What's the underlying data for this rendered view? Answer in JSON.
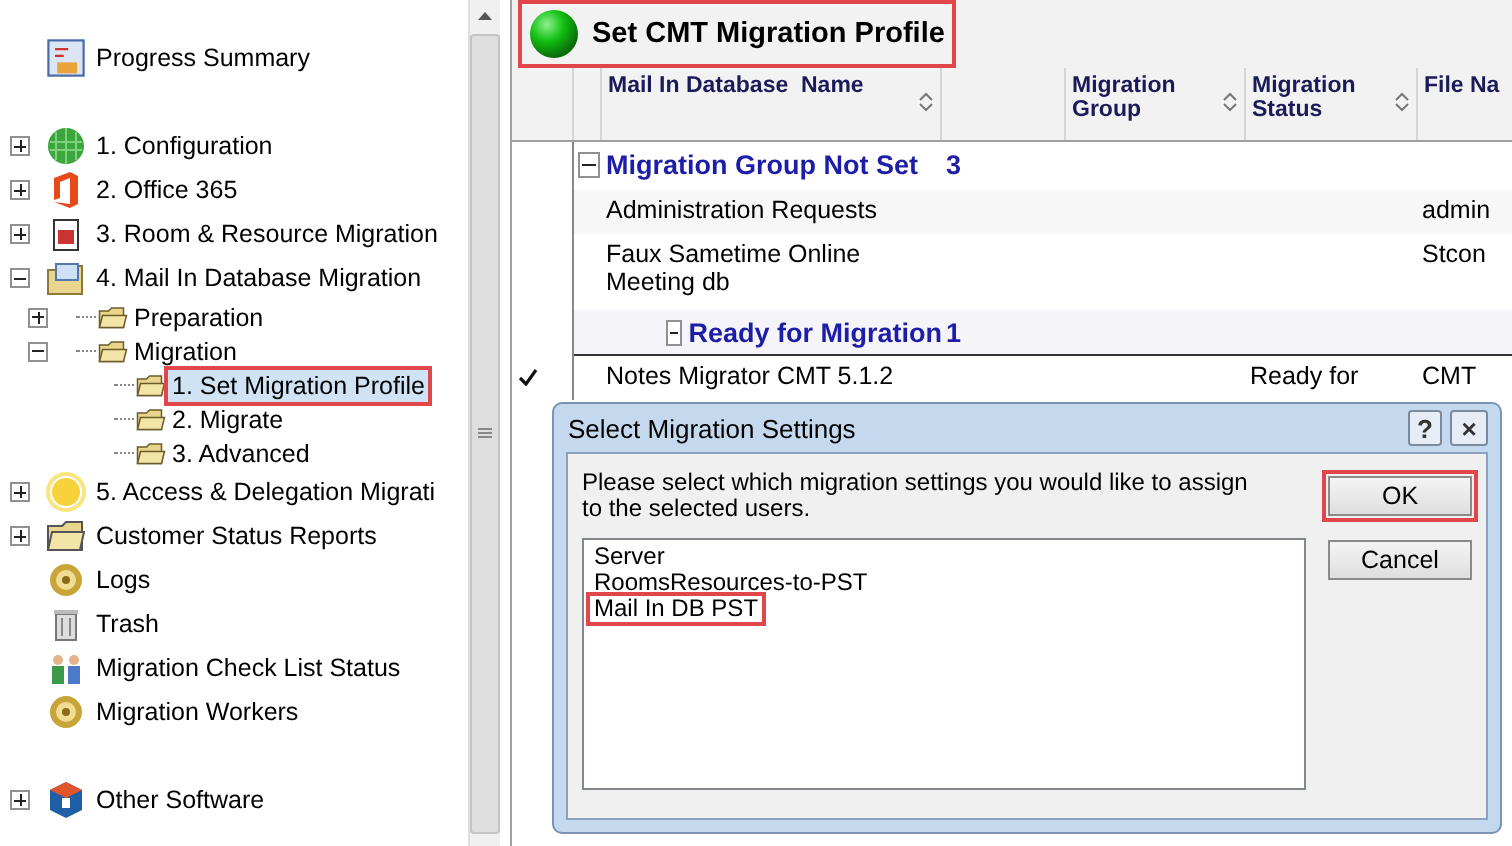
{
  "sidebar": {
    "items": [
      {
        "label": "Progress Summary"
      },
      {
        "label": "1. Configuration",
        "expanded": false
      },
      {
        "label": "2. Office 365",
        "expanded": false
      },
      {
        "label": "3. Room & Resource Migration",
        "expanded": false
      },
      {
        "label": "4. Mail In Database Migration",
        "expanded": true,
        "children": [
          {
            "label": "Preparation",
            "expanded": false
          },
          {
            "label": "Migration",
            "expanded": true,
            "children": [
              {
                "label": "1. Set Migration Profile",
                "selected": true,
                "highlighted": true
              },
              {
                "label": "2. Migrate",
                "selected": false,
                "highlighted": false
              },
              {
                "label": "3. Advanced",
                "selected": false,
                "highlighted": false
              }
            ]
          }
        ]
      },
      {
        "label": "5. Access & Delegation Migrati",
        "expanded": false
      },
      {
        "label": "Customer Status Reports",
        "expanded": false
      },
      {
        "label": "Logs"
      },
      {
        "label": "Trash"
      },
      {
        "label": "Migration Check List Status"
      },
      {
        "label": "Migration Workers"
      },
      {
        "label": "Other Software",
        "expanded": false
      }
    ]
  },
  "header": {
    "title": "Set CMT Migration Profile",
    "highlighted": true
  },
  "table": {
    "columns": [
      "Mail In Database  Name",
      "Migration Group",
      "Migration Status",
      "File Na"
    ],
    "rows": [
      {
        "kind": "group",
        "label": "Migration Group Not Set",
        "count": "3",
        "expanded": true
      },
      {
        "kind": "data",
        "name": "Administration Requests",
        "status": "",
        "file": "admin",
        "checked": false
      },
      {
        "kind": "data",
        "name": "Faux Sametime Online Meeting db",
        "status": "",
        "file": "Stcon",
        "checked": false
      },
      {
        "kind": "subgroup",
        "label": "Ready for Migration",
        "count": "1",
        "expanded": true
      },
      {
        "kind": "data",
        "name": "Notes Migrator CMT 5.1.2",
        "status": "Ready for",
        "file": "CMT",
        "checked": true
      }
    ]
  },
  "dialog": {
    "title": "Select Migration Settings",
    "help": "?",
    "close": "×",
    "message": "Please select which migration settings you would like to assign to the selected users.",
    "options": [
      {
        "label": "Server",
        "highlighted": false
      },
      {
        "label": "RoomsResources-to-PST",
        "highlighted": false
      },
      {
        "label": "Mail In DB PST",
        "highlighted": true
      }
    ],
    "buttons": [
      {
        "label": "OK",
        "highlighted": true
      },
      {
        "label": "Cancel",
        "highlighted": false
      }
    ]
  }
}
